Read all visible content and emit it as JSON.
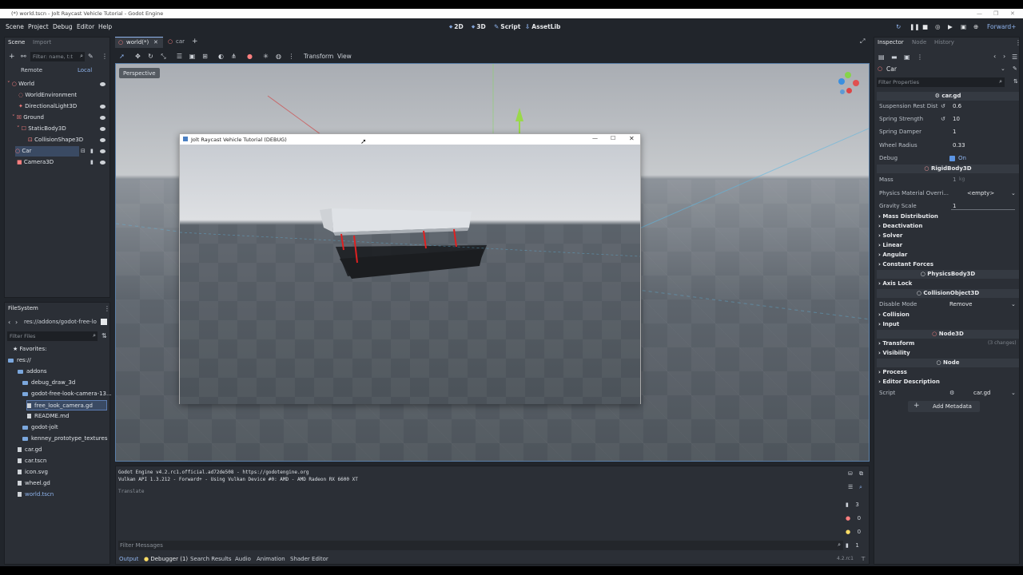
{
  "window": {
    "title": "(*) world.tscn - Jolt Raycast Vehicle Tutorial - Godot Engine"
  },
  "menubar": {
    "items": [
      "Scene",
      "Project",
      "Debug",
      "Editor",
      "Help"
    ],
    "workspaces": [
      "2D",
      "3D",
      "Script",
      "AssetLib"
    ],
    "renderer": "Forward+"
  },
  "scene_dock": {
    "tabs": [
      "Scene",
      "Import"
    ],
    "filter_placeholder": "Filter: name, t:t",
    "remote": "Remote",
    "local": "Local",
    "tree": [
      {
        "label": "World"
      },
      {
        "label": "WorldEnvironment"
      },
      {
        "label": "DirectionalLight3D"
      },
      {
        "label": "Ground"
      },
      {
        "label": "StaticBody3D"
      },
      {
        "label": "CollisionShape3D"
      },
      {
        "label": "Car"
      },
      {
        "label": "Camera3D"
      }
    ]
  },
  "filesystem": {
    "title": "FileSystem",
    "path": "res://addons/godot-free-lo",
    "filter_placeholder": "Filter Files",
    "items": [
      {
        "label": "Favorites:"
      },
      {
        "label": "res://"
      },
      {
        "label": "addons"
      },
      {
        "label": "debug_draw_3d"
      },
      {
        "label": "godot-free-look-camera-13..."
      },
      {
        "label": "free_look_camera.gd"
      },
      {
        "label": "README.md"
      },
      {
        "label": "godot-jolt"
      },
      {
        "label": "kenney_prototype_textures"
      },
      {
        "label": "car.gd"
      },
      {
        "label": "car.tscn"
      },
      {
        "label": "icon.svg"
      },
      {
        "label": "wheel.gd"
      },
      {
        "label": "world.tscn"
      }
    ]
  },
  "editor_tabs": [
    "world(*)",
    "car"
  ],
  "viewport": {
    "toolbar_menus": [
      "Transform",
      "View"
    ],
    "perspective": "Perspective"
  },
  "game_window": {
    "title": "Jolt Raycast Vehicle Tutorial (DEBUG)"
  },
  "output": {
    "line1": "Godot Engine v4.2.rc1.official.ad72de508 - https://godotengine.org",
    "line2": "Vulkan API 1.3.212 - Forward+ - Using Vulkan Device #0: AMD - AMD Radeon RX 6600 XT",
    "line3": "Translate",
    "filter_placeholder": "Filter Messages",
    "counts": {
      "messages": "3",
      "errors": "0",
      "warnings": "0",
      "info": "1"
    },
    "tabs": [
      "Output",
      "Debugger (1)",
      "Search Results",
      "Audio",
      "Animation",
      "Shader Editor"
    ],
    "version": "4.2.rc1"
  },
  "inspector": {
    "tabs": [
      "Inspector",
      "Node",
      "History"
    ],
    "node": "Car",
    "filter_placeholder": "Filter Properties",
    "script_cat": "car.gd",
    "props": [
      {
        "label": "Suspension Rest Dist",
        "value": "0.6"
      },
      {
        "label": "Spring Strength",
        "value": "10"
      },
      {
        "label": "Spring Damper",
        "value": "1"
      },
      {
        "label": "Wheel Radius",
        "value": "0.33"
      },
      {
        "label": "Debug",
        "value": "On"
      }
    ],
    "rigid_cat": "RigidBody3D",
    "mass_label": "Mass",
    "mass_value": "1",
    "mass_unit": "kg",
    "pm_label": "Physics Material Overri...",
    "pm_value": "<empty>",
    "gs_label": "Gravity Scale",
    "gs_value": "1",
    "sections1": [
      "Mass Distribution",
      "Deactivation",
      "Solver",
      "Linear",
      "Angular",
      "Constant Forces"
    ],
    "physics_cat": "PhysicsBody3D",
    "axis_lock": "Axis Lock",
    "collision_cat": "CollisionObject3D",
    "disable_label": "Disable Mode",
    "disable_value": "Remove",
    "sections2": [
      "Collision",
      "Input"
    ],
    "node3d_cat": "Node3D",
    "transform": "Transform",
    "transform_changes": "(3 changes)",
    "visibility": "Visibility",
    "node_cat": "Node",
    "process": "Process",
    "editor_desc": "Editor Description",
    "script_label": "Script",
    "script_value": "car.gd",
    "add_metadata": "Add Metadata"
  }
}
